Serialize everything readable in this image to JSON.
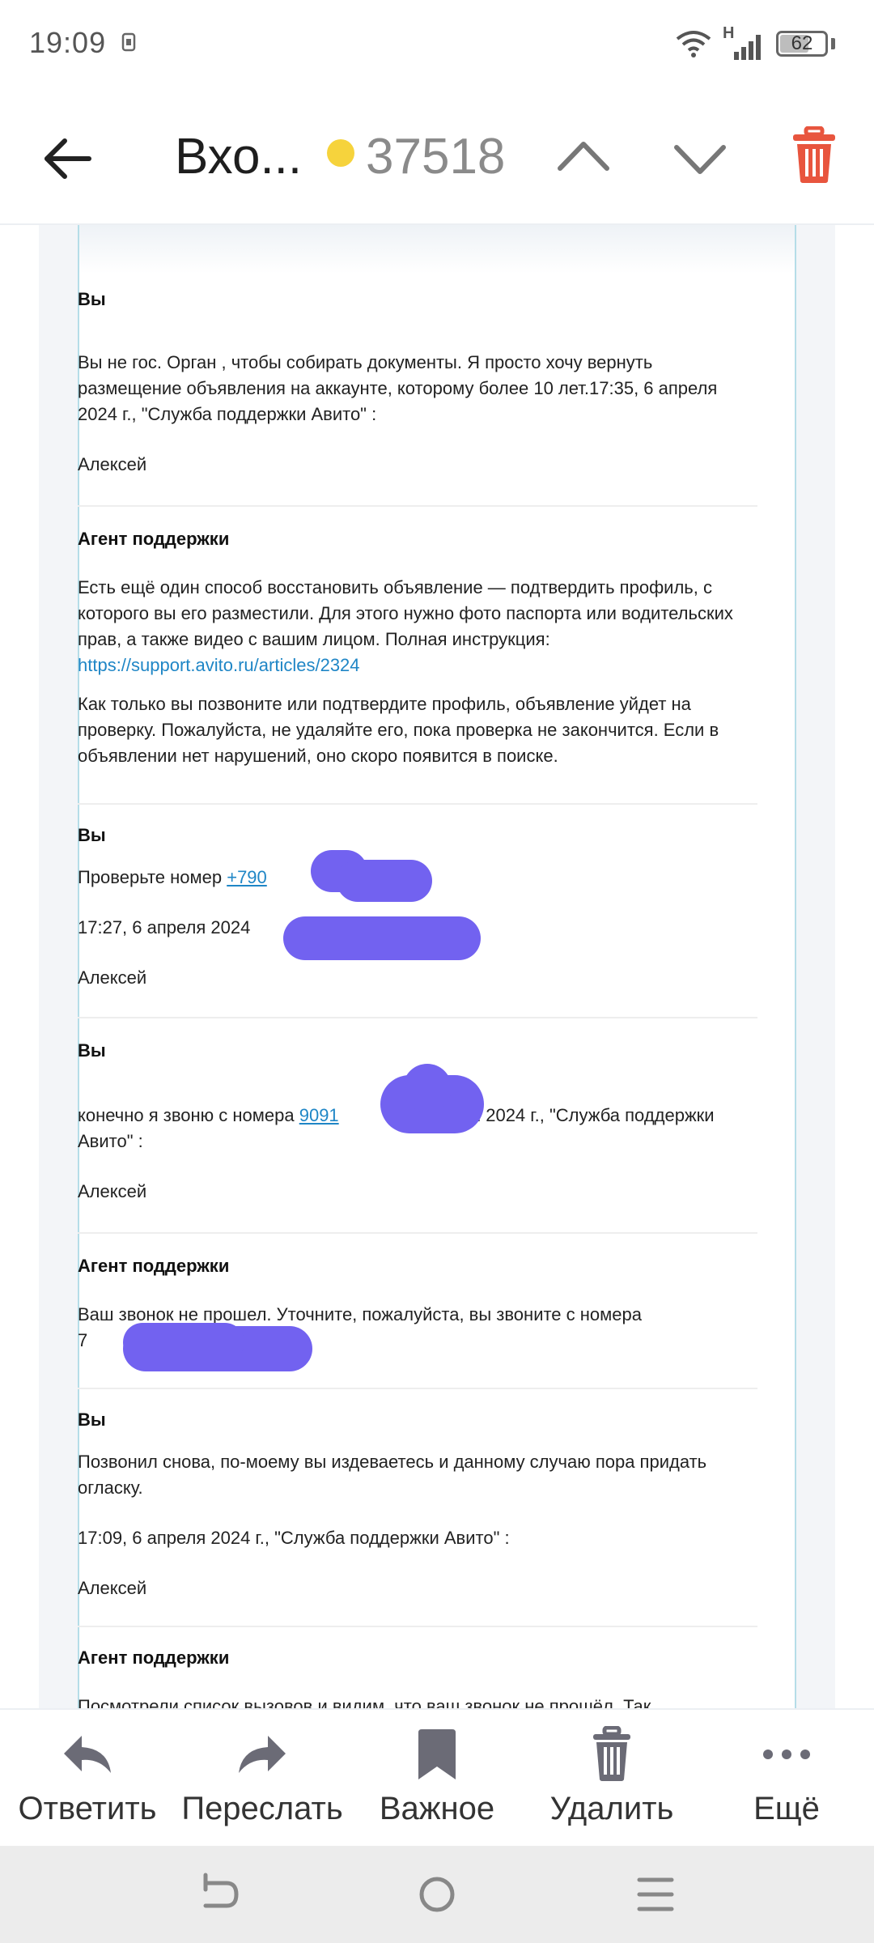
{
  "status_bar": {
    "time": "19:09",
    "network_label": "H",
    "battery": "62"
  },
  "toolbar": {
    "title": "Вхо...",
    "unread_count": "37518"
  },
  "messages": [
    {
      "author": "Вы",
      "paragraphs": [
        "Вы не гос. Орган , чтобы собирать документы. Я просто хочу вернуть размещение объявления на аккаунте, которому более 10 лет.17:35, 6 апреля 2024 г., \"Служба поддержки Авито\" :",
        "Алексей"
      ]
    },
    {
      "author": "Агент поддержки",
      "p1": "Есть ещё один способ восстановить объявление — подтвердить профиль, с которого вы его разместили. Для этого нужно фото паспорта или водительских прав, а также видео с вашим лицом. Полная инструкция:",
      "link": "https://support.avito.ru/articles/2324",
      "p2": "Как только вы позвоните или подтвердите профиль, объявление уйдет на проверку. Пожалуйста, не удаляйте его, пока проверка не закончится. Если в объявлении нет нарушений, оно скоро появится в поиске."
    },
    {
      "author": "Вы",
      "line1_text": "Проверьте номер ",
      "line1_link": "+790",
      "line2": "17:27, 6 апреля 2024",
      "signature": "Алексей"
    },
    {
      "author": "Вы",
      "text_before": "конечно я звоню с номера ",
      "link": "9091",
      "text_after": "5, 6 апреля 2024 г., \"Служба поддержки Авито\" :",
      "signature": "Алексей"
    },
    {
      "author": "Агент поддержки",
      "text": "Ваш звонок не прошел. Уточните, пожалуйста, вы звоните с номера",
      "partial": "7"
    },
    {
      "author": "Вы",
      "p1": "Позвонил снова, по-моему вы издеваетесь и данному случаю пора придать огласку.",
      "p2": "17:09, 6 апреля 2024 г., \"Служба поддержки Авито\" :",
      "signature": "Алексей"
    },
    {
      "author": "Агент поддержки",
      "cut_text": "Посмотрели список вызовов и видим, что ваш звонок не прошёл. Так"
    }
  ],
  "actions": [
    {
      "label": "Ответить",
      "icon": "reply-icon"
    },
    {
      "label": "Переслать",
      "icon": "forward-icon"
    },
    {
      "label": "Важное",
      "icon": "bookmark-icon"
    },
    {
      "label": "Удалить",
      "icon": "trash-icon"
    },
    {
      "label": "Ещё",
      "icon": "more-icon"
    }
  ],
  "colors": {
    "accent_link": "#1f86c6",
    "unread_dot": "#f6d33c",
    "delete_red": "#e8553e",
    "redaction": "#7262f0"
  }
}
